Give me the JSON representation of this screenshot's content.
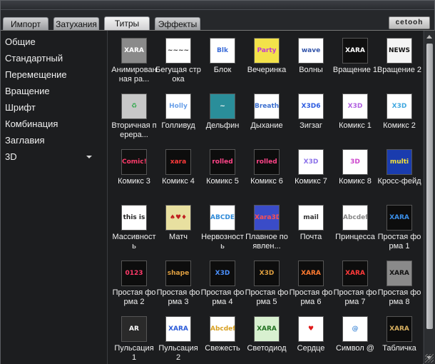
{
  "tabs": [
    "Импорт",
    "Затухания",
    "Титры",
    "Эффекты"
  ],
  "active_tab": "Титры",
  "logo_text": "cetooh",
  "sidebar": {
    "items": [
      "Общие",
      "Стандартный",
      "Перемещение",
      "Вращение",
      "Шрифт",
      "Комбинация",
      "Заглавия",
      "3D"
    ],
    "expandable_item": "3D"
  },
  "styles": [
    {
      "label": "Анимированная ра...",
      "thumb_text": "XARA",
      "bg": "#8a8a8a",
      "fg": "#ffffff",
      "icon": "animated-text-thumb"
    },
    {
      "label": "Бегущая строка",
      "thumb_text": "~~~~",
      "bg": "#ffffff",
      "fg": "#333333",
      "icon": "ticker-thumb"
    },
    {
      "label": "Блок",
      "thumb_text": "Blk",
      "bg": "#ffffff",
      "fg": "#3a6bd8",
      "icon": "block-thumb"
    },
    {
      "label": "Вечеринка",
      "thumb_text": "Party",
      "bg": "#f3e24a",
      "fg": "#c23bd0",
      "icon": "party-thumb"
    },
    {
      "label": "Волны",
      "thumb_text": "wave",
      "bg": "#ffffff",
      "fg": "#3355aa",
      "icon": "waves-thumb"
    },
    {
      "label": "Вращение 1",
      "thumb_text": "XARA",
      "bg": "#101010",
      "fg": "#ffffff",
      "icon": "rotate-thumb"
    },
    {
      "label": "Вращение 2",
      "thumb_text": "NEWS",
      "bg": "#f4f4f4",
      "fg": "#111111",
      "icon": "rotate-thumb"
    },
    {
      "label": "Вторичная перера...",
      "thumb_text": "♻",
      "bg": "#c8c8c8",
      "fg": "#2ea84a",
      "icon": "recycle-thumb"
    },
    {
      "label": "Голливуд",
      "thumb_text": "Holly",
      "bg": "#ffffff",
      "fg": "#6aa0e8",
      "icon": "hollywood-thumb"
    },
    {
      "label": "Дельфин",
      "thumb_text": "~",
      "bg": "#2a8e9a",
      "fg": "#ffffff",
      "icon": "dolphin-thumb"
    },
    {
      "label": "Дыхание",
      "thumb_text": "Breath",
      "bg": "#ffffff",
      "fg": "#3b6fd0",
      "icon": "breath-thumb"
    },
    {
      "label": "Зигзаг",
      "thumb_text": "X3D6",
      "bg": "#ffffff",
      "fg": "#2c5be0",
      "icon": "zigzag-thumb"
    },
    {
      "label": "Комикс 1",
      "thumb_text": "X3D",
      "bg": "#ffffff",
      "fg": "#b060e0",
      "icon": "comic-thumb"
    },
    {
      "label": "Комикс 2",
      "thumb_text": "X3D",
      "bg": "#ffffff",
      "fg": "#40a8e0",
      "icon": "comic-thumb"
    },
    {
      "label": "Комикс 3",
      "thumb_text": "Comic!",
      "bg": "#111111",
      "fg": "#ff3b6a",
      "icon": "comic-thumb"
    },
    {
      "label": "Комикс 4",
      "thumb_text": "xara",
      "bg": "#0d0d0d",
      "fg": "#ff3a3a",
      "icon": "comic-thumb"
    },
    {
      "label": "Комикс 5",
      "thumb_text": "rolled",
      "bg": "#0d0d0d",
      "fg": "#ff4488",
      "icon": "comic-thumb"
    },
    {
      "label": "Комикс 6",
      "thumb_text": "rolled",
      "bg": "#0d0d0d",
      "fg": "#ff4488",
      "icon": "comic-thumb"
    },
    {
      "label": "Комикс 7",
      "thumb_text": "X3D",
      "bg": "#ffffff",
      "fg": "#8a70e8",
      "icon": "comic-thumb"
    },
    {
      "label": "Комикс 8",
      "thumb_text": "3D",
      "bg": "#ffffff",
      "fg": "#cc44cc",
      "icon": "comic-thumb"
    },
    {
      "label": "Кросс-фейд",
      "thumb_text": "multi",
      "bg": "#1a3cae",
      "fg": "#f5e23a",
      "icon": "crossfade-thumb"
    },
    {
      "label": "Массивность",
      "thumb_text": "this is",
      "bg": "#ffffff",
      "fg": "#222222",
      "icon": "massive-thumb"
    },
    {
      "label": "Матч",
      "thumb_text": "♠♥♦",
      "bg": "#e8e0a0",
      "fg": "#c02020",
      "icon": "match-thumb"
    },
    {
      "label": "Нервозность",
      "thumb_text": "ABCDEF",
      "bg": "#ffffff",
      "fg": "#2f8ad8",
      "icon": "nervous-thumb"
    },
    {
      "label": "Плавное появлен...",
      "thumb_text": "Xara3D",
      "bg": "#3a4cc8",
      "fg": "#ff5050",
      "icon": "fade-in-thumb"
    },
    {
      "label": "Почта",
      "thumb_text": "mail",
      "bg": "#ffffff",
      "fg": "#333333",
      "icon": "mail-thumb"
    },
    {
      "label": "Принцесса",
      "thumb_text": "Abcdef",
      "bg": "#ffffff",
      "fg": "#888888",
      "icon": "princess-thumb"
    },
    {
      "label": "Простая форма 1",
      "thumb_text": "XARA",
      "bg": "#0d0d0d",
      "fg": "#3a8ee8",
      "icon": "shape-thumb"
    },
    {
      "label": "Простая форма 2",
      "thumb_text": "0123",
      "bg": "#0d0d0d",
      "fg": "#ff3a6a",
      "icon": "shape-thumb"
    },
    {
      "label": "Простая форма 3",
      "thumb_text": "shape",
      "bg": "#0d0d0d",
      "fg": "#e0a040",
      "icon": "shape-thumb"
    },
    {
      "label": "Простая форма 4",
      "thumb_text": "X3D",
      "bg": "#0d0d0d",
      "fg": "#4a90ff",
      "icon": "shape-thumb"
    },
    {
      "label": "Простая форма 5",
      "thumb_text": "X3D",
      "bg": "#0d0d0d",
      "fg": "#e0a040",
      "icon": "shape-thumb"
    },
    {
      "label": "Простая форма 6",
      "thumb_text": "XARA",
      "bg": "#0d0d0d",
      "fg": "#ff7a30",
      "icon": "shape-thumb"
    },
    {
      "label": "Простая форма 7",
      "thumb_text": "XARA",
      "bg": "#0d0d0d",
      "fg": "#ff3a3a",
      "icon": "shape-thumb"
    },
    {
      "label": "Простая форма 8",
      "thumb_text": "XARA",
      "bg": "#8a8a8a",
      "fg": "#111111",
      "icon": "shape-thumb"
    },
    {
      "label": "Пульсация 1",
      "thumb_text": "AR",
      "bg": "#2a2a2a",
      "fg": "#ffffff",
      "icon": "pulse-thumb"
    },
    {
      "label": "Пульсация 2",
      "thumb_text": "XARA",
      "bg": "#ffffff",
      "fg": "#2a5ad8",
      "icon": "pulse-thumb"
    },
    {
      "label": "Свежесть",
      "thumb_text": "Abcdef",
      "bg": "#ffffff",
      "fg": "#d8a020",
      "icon": "fresh-thumb"
    },
    {
      "label": "Светодиод",
      "thumb_text": "XARA",
      "bg": "#d8f0d0",
      "fg": "#207020",
      "icon": "led-thumb"
    },
    {
      "label": "Сердце",
      "thumb_text": "♥",
      "bg": "#ffffff",
      "fg": "#e01a1a",
      "icon": "heart-thumb"
    },
    {
      "label": "Символ @",
      "thumb_text": "@",
      "bg": "#ffffff",
      "fg": "#4a8ed8",
      "icon": "at-symbol-thumb"
    },
    {
      "label": "Табличка",
      "thumb_text": "XARA",
      "bg": "#0d0d0d",
      "fg": "#d8b060",
      "icon": "sign-thumb"
    }
  ]
}
